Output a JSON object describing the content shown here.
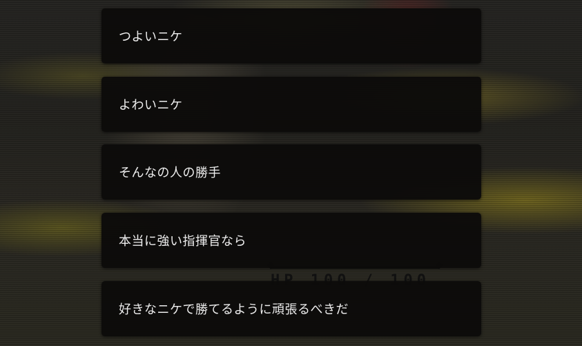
{
  "hud": {
    "hp_text": "HP 100 / 100"
  },
  "choices": [
    {
      "label": "つよいニケ"
    },
    {
      "label": "よわいニケ"
    },
    {
      "label": "そんなの人の勝手"
    },
    {
      "label": "本当に強い指揮官なら"
    },
    {
      "label": "好きなニケで勝てるように頑張るべきだ"
    }
  ],
  "colors": {
    "choice_background": "#0c0b0a",
    "choice_text": "#ededed",
    "background_grass": "#a8961c",
    "background_dark": "#262522"
  }
}
